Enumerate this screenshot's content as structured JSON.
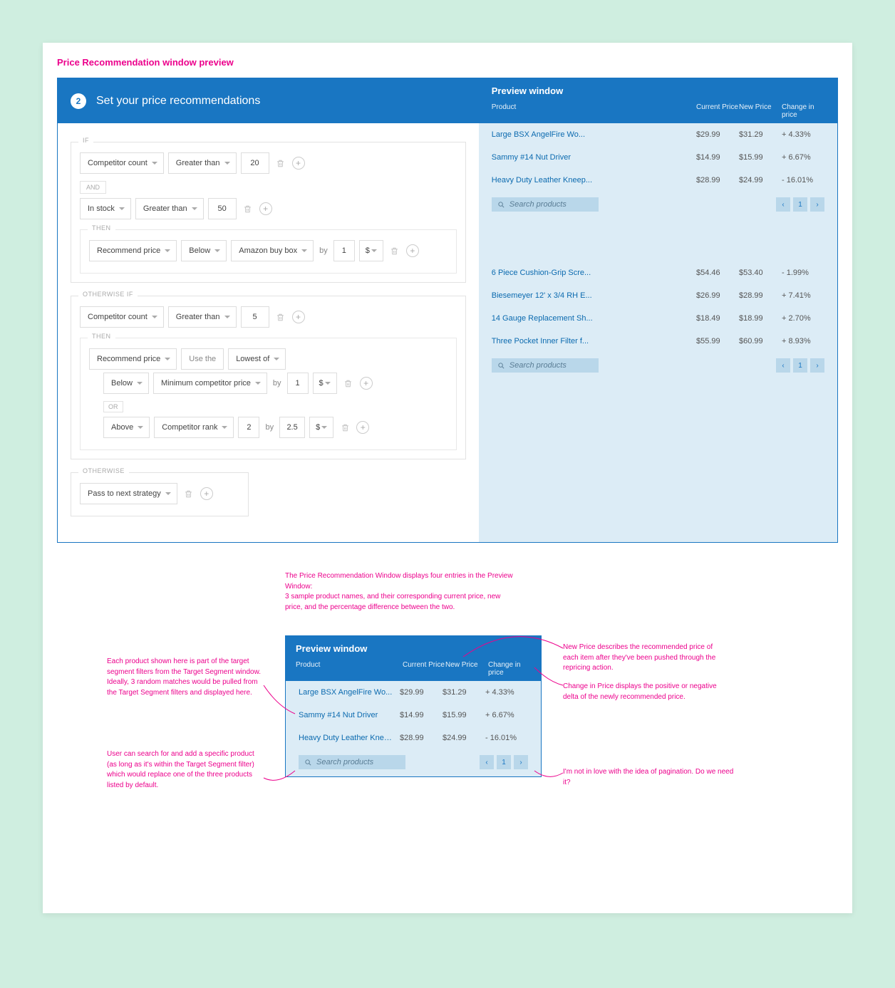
{
  "page_title": "Price Recommendation window preview",
  "header": {
    "step": "2",
    "title": "Set your price recommendations"
  },
  "preview_header": {
    "heading": "Preview window",
    "cols": {
      "product": "Product",
      "current": "Current Price",
      "new": "New Price",
      "change": "Change in price"
    }
  },
  "labels": {
    "if": "IF",
    "and": "AND",
    "then": "THEN",
    "otherwise_if": "OTHERWISE IF",
    "otherwise": "OTHERWISE",
    "or": "OR",
    "by": "by",
    "use_the": "Use the",
    "search_placeholder": "Search products",
    "page": "1"
  },
  "rules": {
    "if1": {
      "field": "Competitor count",
      "op": "Greater than",
      "val": "20"
    },
    "and1": {
      "field": "In stock",
      "op": "Greater than",
      "val": "50"
    },
    "then1": {
      "action": "Recommend price",
      "dir": "Below",
      "ref": "Amazon buy box",
      "amount": "1",
      "unit": "$"
    },
    "oif": {
      "field": "Competitor count",
      "op": "Greater than",
      "val": "5"
    },
    "then2": {
      "action": "Recommend price",
      "agg": "Lowest of",
      "a": {
        "dir": "Below",
        "ref": "Minimum competitor price",
        "amount": "1",
        "unit": "$"
      },
      "b": {
        "dir": "Above",
        "ref": "Competitor rank",
        "rank": "2",
        "amount": "2.5",
        "unit": "$"
      }
    },
    "otherwise": {
      "action": "Pass to next strategy"
    }
  },
  "preview_a": [
    {
      "name": "Large BSX AngelFire Wo...",
      "cp": "$29.99",
      "np": "$31.29",
      "ch": "+ 4.33%"
    },
    {
      "name": "Sammy #14 Nut Driver",
      "cp": "$14.99",
      "np": "$15.99",
      "ch": "+ 6.67%"
    },
    {
      "name": "Heavy Duty Leather Kneep...",
      "cp": "$28.99",
      "np": "$24.99",
      "ch": "- 16.01%"
    }
  ],
  "preview_b": [
    {
      "name": "6 Piece Cushion-Grip Scre...",
      "cp": "$54.46",
      "np": "$53.40",
      "ch": "- 1.99%"
    },
    {
      "name": "Biesemeyer 12' x 3/4 RH E...",
      "cp": "$26.99",
      "np": "$28.99",
      "ch": "+ 7.41%"
    },
    {
      "name": "14 Gauge Replacement Sh...",
      "cp": "$18.49",
      "np": "$18.99",
      "ch": "+ 2.70%"
    },
    {
      "name": "Three Pocket Inner Filter f...",
      "cp": "$55.99",
      "np": "$60.99",
      "ch": "+ 8.93%"
    }
  ],
  "annotations": {
    "intro": "The Price Recommendation Window displays four entries in the Preview Window:\n3 sample product names, and their corresponding current price, new price, and the percentage difference between the two.",
    "target": "Each product shown here is part of the target segment filters from the Target Segment window. Ideally, 3 random matches would be pulled from the Target Segment filters and displayed here.",
    "search": "User can search for and add a specific product (as long as it's within the Target Segment filter) which would replace one of the three products listed by default.",
    "newprice": "New Price describes the recommended price of each item after they've been pushed through the repricing action.",
    "change": "Change in Price displays the positive or negative delta of the newly recommended price.",
    "pagination": "I'm not in love with the idea of pagination. Do we need it?"
  }
}
